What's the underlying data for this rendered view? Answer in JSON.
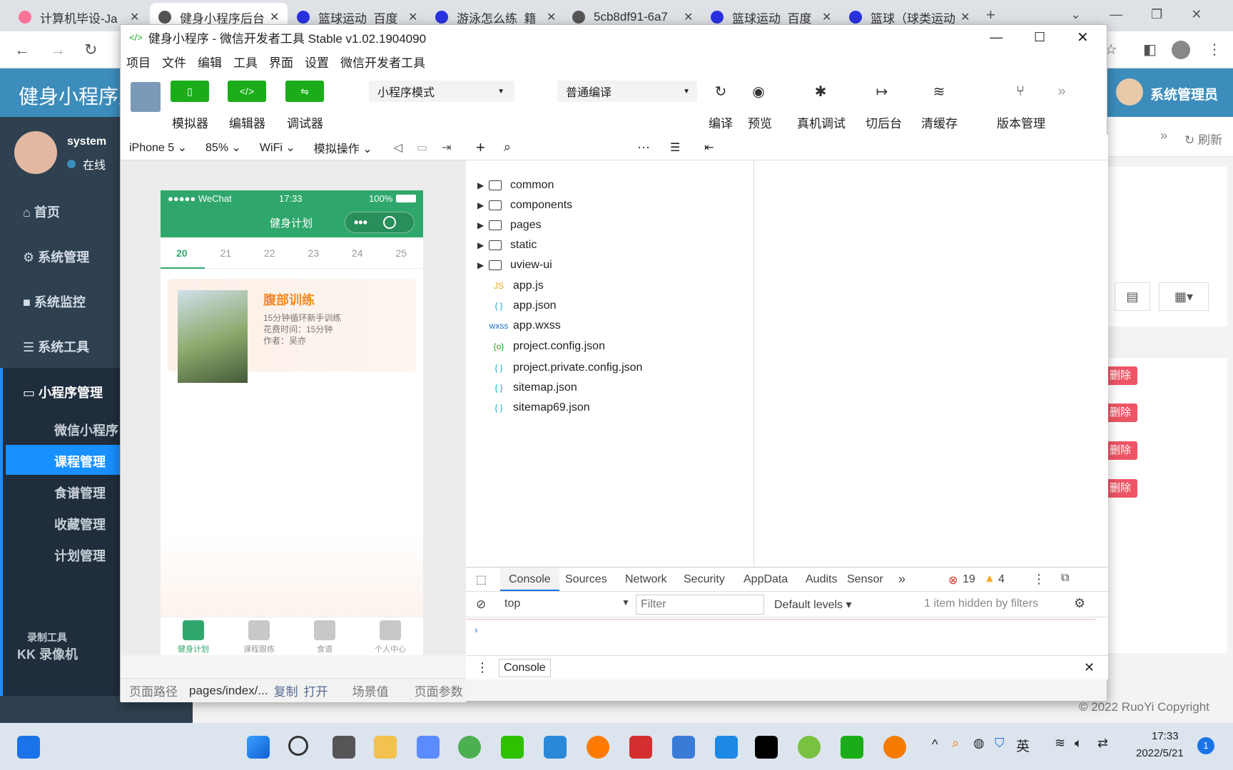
{
  "browser": {
    "tabs": [
      {
        "title": "计算机毕设-Ja",
        "icon_color": "#fb7299",
        "active": false
      },
      {
        "title": "健身小程序后台",
        "icon_color": "#555555",
        "active": true
      },
      {
        "title": "篮球运动_百度",
        "icon_color": "#2932e1",
        "active": false
      },
      {
        "title": "游泳怎么练_籍",
        "icon_color": "#2932e1",
        "active": false
      },
      {
        "title": "5cb8df91-6a7",
        "icon_color": "#555555",
        "active": false
      },
      {
        "title": "篮球运动_百度",
        "icon_color": "#2932e1",
        "active": false
      },
      {
        "title": "篮球（球类运动",
        "icon_color": "#2932e1",
        "active": false
      }
    ],
    "new_tab": "+"
  },
  "ruoyi": {
    "brand": "健身小程序后",
    "user": "system",
    "status": "在线",
    "admin": "系统管理员",
    "refresh": "刷新",
    "menu": [
      "首页",
      "系统管理",
      "系统监控",
      "系统工具"
    ],
    "active_group": "小程序管理",
    "submenu": [
      "微信小程序",
      "课程管理",
      "食谱管理",
      "收藏管理",
      "计划管理"
    ],
    "active_sub": "课程管理",
    "delete_label": "删除",
    "copyright": "© 2022 RuoYi Copyright",
    "watermark_top": "录制工具",
    "watermark_bottom": "KK 录像机"
  },
  "devtools": {
    "title": "健身小程序 - 微信开发者工具 Stable v1.02.1904090",
    "menu": [
      "项目",
      "文件",
      "编辑",
      "工具",
      "界面",
      "设置",
      "微信开发者工具"
    ],
    "tools": {
      "simulator": "模拟器",
      "editor": "编辑器",
      "debugger": "调试器",
      "mode": "小程序模式",
      "compile_mode": "普通编译",
      "compile": "编译",
      "preview": "预览",
      "remote_debug": "真机调试",
      "background": "切后台",
      "clear_cache": "清缓存",
      "version": "版本管理"
    },
    "sim_bar": {
      "device": "iPhone 5",
      "zoom": "85%",
      "network": "WiFi",
      "ops": "模拟操作"
    },
    "files": [
      {
        "name": "common",
        "type": "folder"
      },
      {
        "name": "components",
        "type": "folder"
      },
      {
        "name": "pages",
        "type": "folder"
      },
      {
        "name": "static",
        "type": "folder"
      },
      {
        "name": "uview-ui",
        "type": "folder"
      },
      {
        "name": "app.js",
        "type": "js",
        "icon": "JS",
        "color": "#e8a317"
      },
      {
        "name": "app.json",
        "type": "json",
        "icon": "{ }",
        "color": "#1aa8c7"
      },
      {
        "name": "app.wxss",
        "type": "wxss",
        "icon": "wxss",
        "color": "#1a6fc7"
      },
      {
        "name": "project.config.json",
        "type": "config",
        "icon": "{o}",
        "color": "#1aad19"
      },
      {
        "name": "project.private.config.json",
        "type": "json",
        "icon": "{ }",
        "color": "#1aa8c7"
      },
      {
        "name": "sitemap.json",
        "type": "json",
        "icon": "{ }",
        "color": "#1aa8c7"
      },
      {
        "name": "sitemap69.json",
        "type": "json",
        "icon": "{ }",
        "color": "#1aa8c7"
      }
    ],
    "console": {
      "tabs": [
        "Console",
        "Sources",
        "Network",
        "Security",
        "AppData",
        "Audits",
        "Sensor"
      ],
      "errors": "19",
      "warnings": "4",
      "context": "top",
      "filter_placeholder": "Filter",
      "levels": "Default levels",
      "hidden": "1 item hidden by filters",
      "drawer_tab": "Console"
    },
    "status": {
      "path_label": "页面路径",
      "path": "pages/index/...",
      "copy": "复制",
      "open": "打开",
      "scene": "场景值",
      "params": "页面参数"
    }
  },
  "phone": {
    "carrier": "●●●●● WeChat",
    "time": "17:33",
    "battery": "100%",
    "title": "健身计划",
    "dates": [
      "20",
      "21",
      "22",
      "23",
      "24",
      "25"
    ],
    "active_date": "20",
    "card": {
      "title": "腹部训练",
      "line1": "15分钟循环新手训练",
      "line2": "花费时间：15分钟",
      "line3": "作者：吴亦"
    },
    "tabs": [
      "健身计划",
      "课程跟练",
      "食谱",
      "个人中心"
    ],
    "active_tab": "健身计划",
    "accent": "#2fa76c"
  },
  "taskbar": {
    "lang": "英",
    "time": "17:33",
    "date": "2022/5/21",
    "notifications": "1"
  }
}
